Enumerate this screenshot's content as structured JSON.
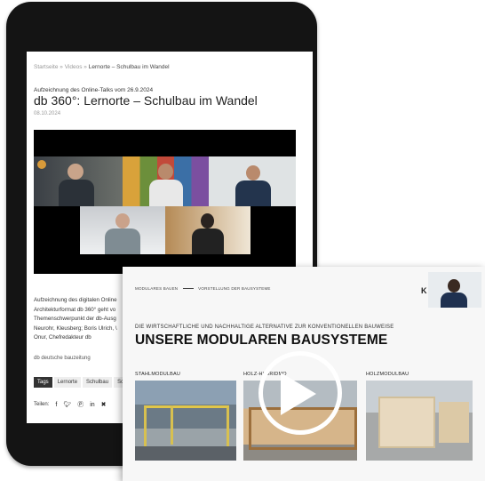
{
  "tablet": {
    "breadcrumb": {
      "home": "Startseite",
      "sep1": "»",
      "section": "Videos",
      "sep2": "»",
      "current": "Lernorte – Schulbau im Wandel"
    },
    "kicker": "Aufzeichnung des Online-Talks vom 26.9.2024",
    "title": "db 360°: Lernorte – Schulbau im Wandel",
    "date": "08.10.2024",
    "body_lines": [
      "Aufzeichnung des digitalen Online",
      "Architekturformat db 360° geht vo",
      "Themenschwerpunkt der db-Ausg",
      "Neurohr, Kleusberg; Boris Ulrich, \\",
      "Onur, Chefredakteur db"
    ],
    "source": "db deutsche bauzeitung",
    "tags": [
      "Tags",
      "Lernorte",
      "Schulbau",
      "Sch"
    ],
    "share_label": "Teilen:",
    "share_icons": [
      "facebook-icon",
      "twitter-icon",
      "pinterest-icon",
      "linkedin-icon",
      "xing-icon"
    ]
  },
  "card": {
    "breadcrumb_a": "MODULARES BAUEN",
    "breadcrumb_b": "VORSTELLUNG DER BAUSYSTEME",
    "logo": "K",
    "subhead": "DIE WIRTSCHAFTLICHE UND NACHHALTIGE ALTERNATIVE ZUR KONVENTIONELLEN BAUWEISE",
    "headline": "UNSERE MODULAREN BAUSYSTEME",
    "columns": [
      "STAHLMODULBAU",
      "HOLZ-HYBRIDMO",
      "HOLZMODULBAU"
    ]
  },
  "colors": {
    "tablet_frame": "#141414",
    "accent": "#6aaed6",
    "play": "#ffffff"
  }
}
